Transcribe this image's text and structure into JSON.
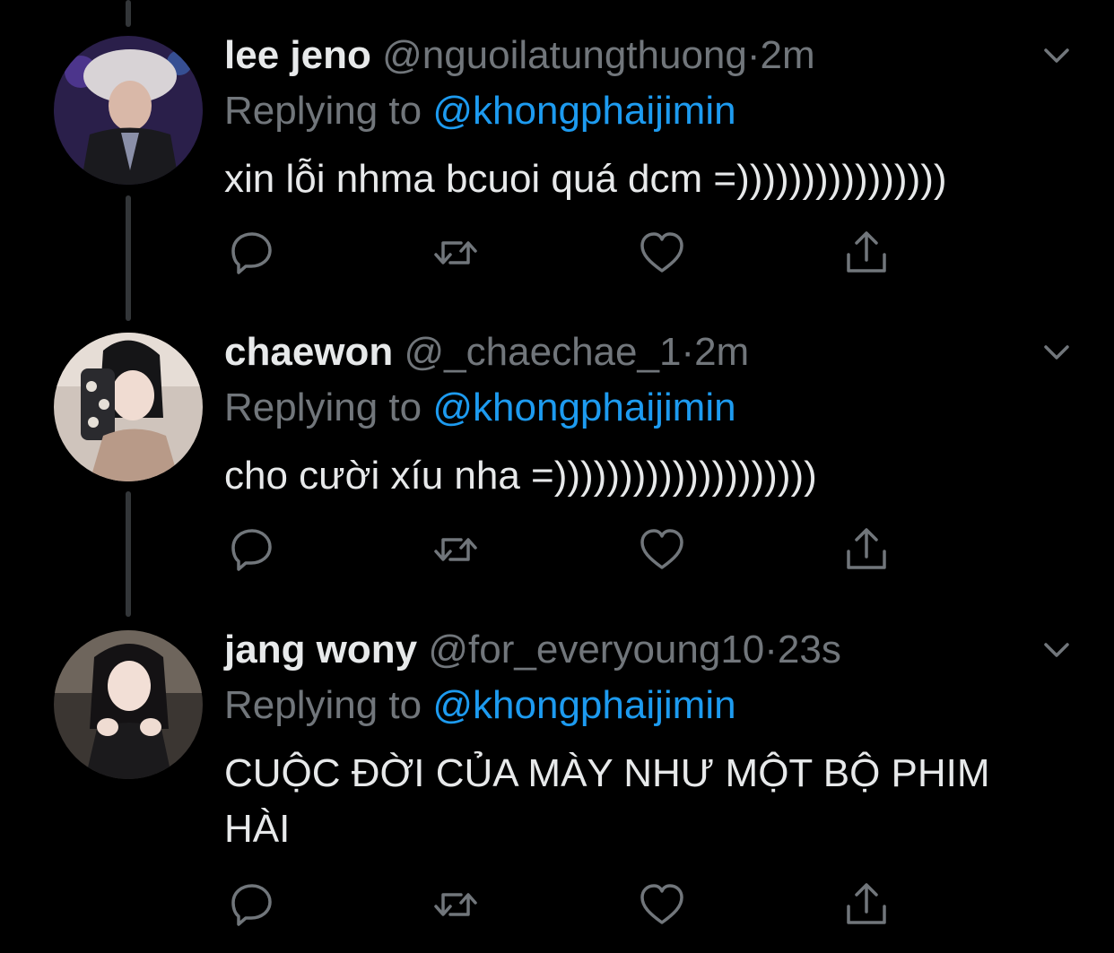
{
  "tweets": [
    {
      "name": "lee jeno",
      "handle": "@nguoilatungthuong",
      "separator": "·",
      "time": "2m",
      "replying_prefix": "Replying to",
      "replying_to": "@khongphaijimin",
      "text": "xin lỗi nhma bcuoi quá dcm =))))))))))))))))"
    },
    {
      "name": "chaewon",
      "handle": "@_chaechae_1",
      "separator": "·",
      "time": "2m",
      "replying_prefix": "Replying to",
      "replying_to": "@khongphaijimin",
      "text": "cho cười xíu nha =))))))))))))))))))))"
    },
    {
      "name": "jang wony",
      "handle": "@for_everyoung10",
      "separator": "·",
      "time": "23s",
      "replying_prefix": "Replying to",
      "replying_to": "@khongphaijimin",
      "text": "CUỘC ĐỜI CỦA MÀY NHƯ MỘT BỘ PHIM HÀI"
    }
  ],
  "icons": {
    "reply": "reply-icon",
    "retweet": "retweet-icon",
    "like": "heart-icon",
    "share": "share-icon",
    "more": "chevron-down-icon"
  },
  "colors": {
    "background": "#000000",
    "text": "#e7e9ea",
    "secondary": "#71767b",
    "accent": "#1d9bf0",
    "thread_line": "#333639"
  }
}
